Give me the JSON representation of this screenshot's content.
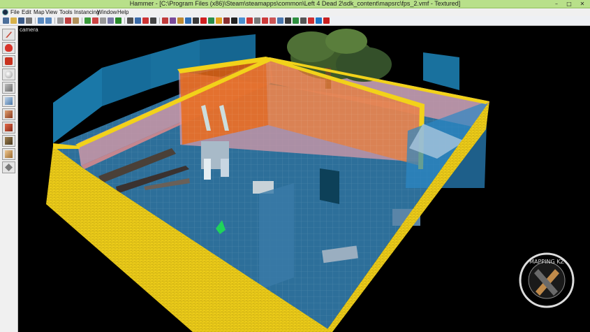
{
  "window": {
    "title": "Hammer - [C:\\Program Files (x86)\\Steam\\steamapps\\common\\Left 4 Dead 2\\sdk_content\\mapsrc\\fps_2.vmf - Textured]",
    "minimize_glyph": "–",
    "maximize_glyph": "□",
    "close_glyph": "✕"
  },
  "menu": {
    "items": [
      "File",
      "Edit",
      "Map",
      "View",
      "Tools",
      "Instancing",
      "Window",
      "Help"
    ]
  },
  "toolbar": {
    "icons": [
      "new-icon",
      "open-icon",
      "save-icon",
      "print-icon",
      "undo-icon",
      "redo-icon",
      "copy-icon",
      "cut-icon",
      "paste-icon",
      "group-icon",
      "ungroup-icon",
      "hide-icon",
      "unhide-icon",
      "toggle-texlock-icon",
      "grid-icon",
      "3d-grid-icon",
      "texture-lock-icon",
      "snap-icon",
      "run-map-icon",
      "carve-icon",
      "entity-report-icon",
      "texture-app-icon",
      "cordon-icon",
      "check-problems-icon"
    ]
  },
  "tools": {
    "items": [
      {
        "name": "selection-tool-icon",
        "color": "#c84b3a"
      },
      {
        "name": "magnify-tool-icon",
        "color": "#d8342a"
      },
      {
        "name": "camera-tool-icon",
        "color": "#c8321f"
      },
      {
        "name": "entity-tool-icon",
        "color": "#f4f4f4"
      },
      {
        "name": "block-tool-icon",
        "color": "#8c8c8c"
      },
      {
        "name": "texture-application-icon",
        "color": "#7aa0c9"
      },
      {
        "name": "apply-texture-icon",
        "color": "#b65c3a"
      },
      {
        "name": "decal-tool-icon",
        "color": "#c0472f"
      },
      {
        "name": "overlay-tool-icon",
        "color": "#6f5a3a"
      },
      {
        "name": "clipping-tool-icon",
        "color": "#d1a66b"
      },
      {
        "name": "vertex-tool-icon",
        "color": "#7a7a7a"
      }
    ]
  },
  "viewport": {
    "label": "camera",
    "colors": {
      "floor": "#2d6f9a",
      "wall_yellow": "#f2d21a",
      "wall_orange": "#e86a1a",
      "wall_pink": "#d69aa8",
      "water_blue": "#1f8dc6"
    }
  },
  "watermark": {
    "text": "MAPPING KZ"
  }
}
